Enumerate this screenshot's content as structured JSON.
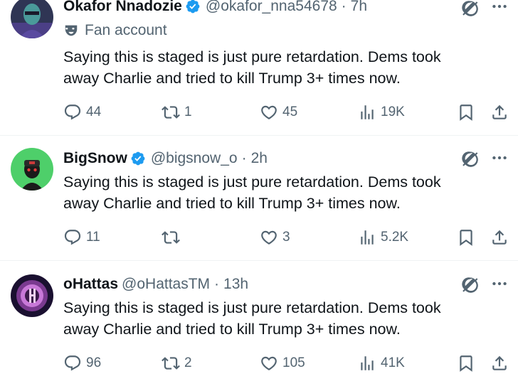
{
  "colors": {
    "text": "#0f1419",
    "muted": "#536471",
    "verified": "#1d9bf0",
    "divider": "#eff3f4"
  },
  "tweets": [
    {
      "name": "Okafor Nnadozie",
      "handle": "@okafor_nna54678",
      "time": "7h",
      "label": "Fan account",
      "text_line1": "Saying this is staged is just pure retardation. Dems took",
      "text_line2": "away Charlie and tried to kill Trump 3+ times now.",
      "replies": "44",
      "reposts": "1",
      "likes": "45",
      "views": "19K",
      "verified": true
    },
    {
      "name": "BigSnow",
      "handle": "@bigsnow_o",
      "time": "2h",
      "text_line1": "Saying this is staged is just pure retardation. Dems took",
      "text_line2": "away Charlie and tried to kill Trump 3+ times now.",
      "replies": "11",
      "reposts": "",
      "likes": "3",
      "views": "5.2K",
      "verified": true
    },
    {
      "name": "oHattas",
      "handle": "@oHattasTM",
      "time": "13h",
      "text_line1": "Saying this is staged is just pure retardation. Dems took",
      "text_line2": "away Charlie and tried to kill Trump 3+ times now.",
      "replies": "96",
      "reposts": "2",
      "likes": "105",
      "views": "41K",
      "verified": false
    }
  ],
  "separator": "·"
}
